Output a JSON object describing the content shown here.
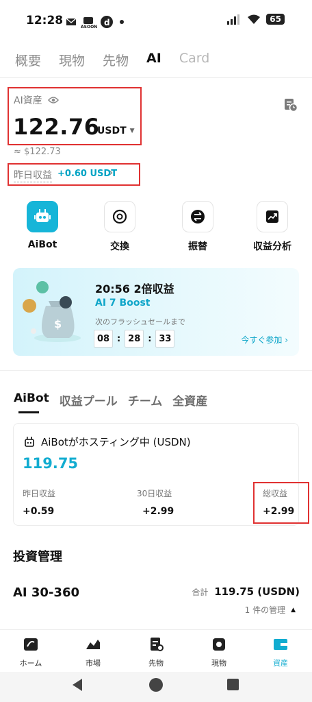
{
  "status_bar": {
    "time": "12:28",
    "notif_label": "ASOON",
    "battery": "65"
  },
  "top_tabs": [
    {
      "label": "概要"
    },
    {
      "label": "現物"
    },
    {
      "label": "先物"
    },
    {
      "label": "AI"
    },
    {
      "label": "Card"
    }
  ],
  "asset": {
    "label": "AI資産",
    "value": "122.76",
    "unit": "USDT",
    "approx": "≈ $122.73",
    "yesterday_label": "昨日収益",
    "yesterday_value": "+0.60 USDT"
  },
  "actions": [
    {
      "label": "AiBot",
      "icon": "robot-icon"
    },
    {
      "label": "交換",
      "icon": "exchange-icon"
    },
    {
      "label": "振替",
      "icon": "transfer-icon"
    },
    {
      "label": "収益分析",
      "icon": "chart-trend-icon"
    }
  ],
  "promo": {
    "title": "20:56 2倍収益",
    "subtitle": "AI 7 Boost",
    "next_label": "次のフラッシュセールまで",
    "timer": [
      "08",
      "28",
      "33"
    ],
    "join_label": "今すぐ参加"
  },
  "sub_tabs": [
    {
      "label": "AiBot"
    },
    {
      "label": "収益プール"
    },
    {
      "label": "チーム"
    },
    {
      "label": "全資産"
    }
  ],
  "aibot_card": {
    "title": "AiBotがホスティング中 (USDN)",
    "value": "119.75",
    "stats": [
      {
        "label": "昨日収益",
        "value": "+0.59"
      },
      {
        "label": "30日収益",
        "value": "+2.99"
      },
      {
        "label": "総収益",
        "value": "+2.99"
      }
    ]
  },
  "invest": {
    "title": "投資管理",
    "name": "AI 30-360",
    "total_label": "合計",
    "total_value": "119.75 (USDN)",
    "manage_label": "1 件の管理"
  },
  "bottom_nav": [
    {
      "label": "ホーム",
      "icon": "home-icon"
    },
    {
      "label": "市場",
      "icon": "market-icon"
    },
    {
      "label": "先物",
      "icon": "futures-icon"
    },
    {
      "label": "現物",
      "icon": "spot-icon"
    },
    {
      "label": "資産",
      "icon": "wallet-icon"
    }
  ],
  "colors": {
    "accent": "#12acd0",
    "highlight": "#e03131"
  }
}
